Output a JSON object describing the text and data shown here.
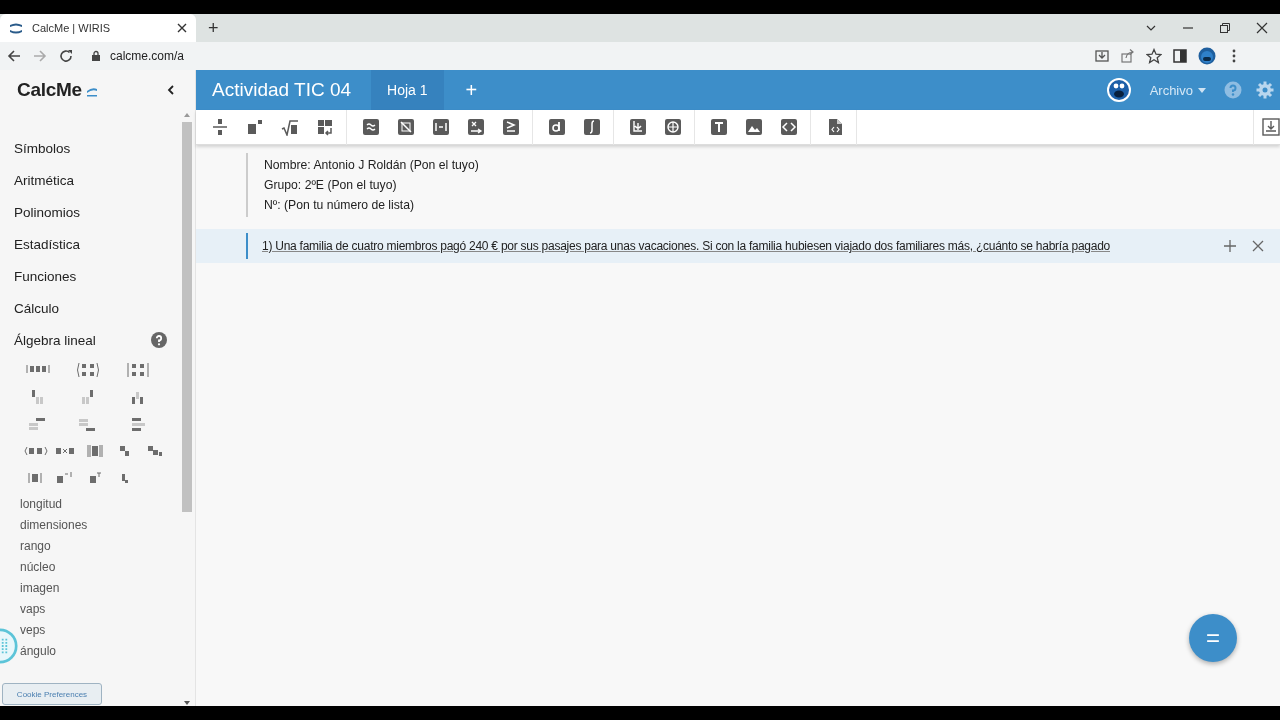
{
  "browser": {
    "tab_title": "CalcMe | WIRIS",
    "new_tab": "+",
    "url": "calcme.com/a"
  },
  "sidebar": {
    "logo": "CalcMe",
    "categories": [
      {
        "label": "Símbolos"
      },
      {
        "label": "Aritmética"
      },
      {
        "label": "Polinomios"
      },
      {
        "label": "Estadística"
      },
      {
        "label": "Funciones"
      },
      {
        "label": "Cálculo"
      },
      {
        "label": "Álgebra lineal",
        "commands": [
          "longitud",
          "dimensiones",
          "rango",
          "núcleo",
          "imagen",
          "vaps",
          "veps",
          "ángulo"
        ]
      }
    ]
  },
  "cookie_button": "Cookie Preferences",
  "header": {
    "title": "Actividad TIC 04",
    "tabs": [
      {
        "label": "Hoja 1",
        "selected": true
      }
    ],
    "add": "+",
    "menu": "Archivo"
  },
  "document": {
    "blocks": [
      {
        "kind": "text",
        "selected": false,
        "lines": [
          "Nombre: Antonio J Roldán (Pon el tuyo)",
          "Grupo: 2ºE (Pon el tuyo)",
          "Nº: (Pon tu número de lista)"
        ]
      },
      {
        "kind": "question",
        "selected": true,
        "lines": [
          "1) Una familia de cuatro miembros pagó 240 € por sus pasajes para unas vacaciones. Si con la familia hubiesen viajado dos familiares más, ¿cuánto se habría pagado"
        ]
      }
    ]
  },
  "calc_button": "="
}
